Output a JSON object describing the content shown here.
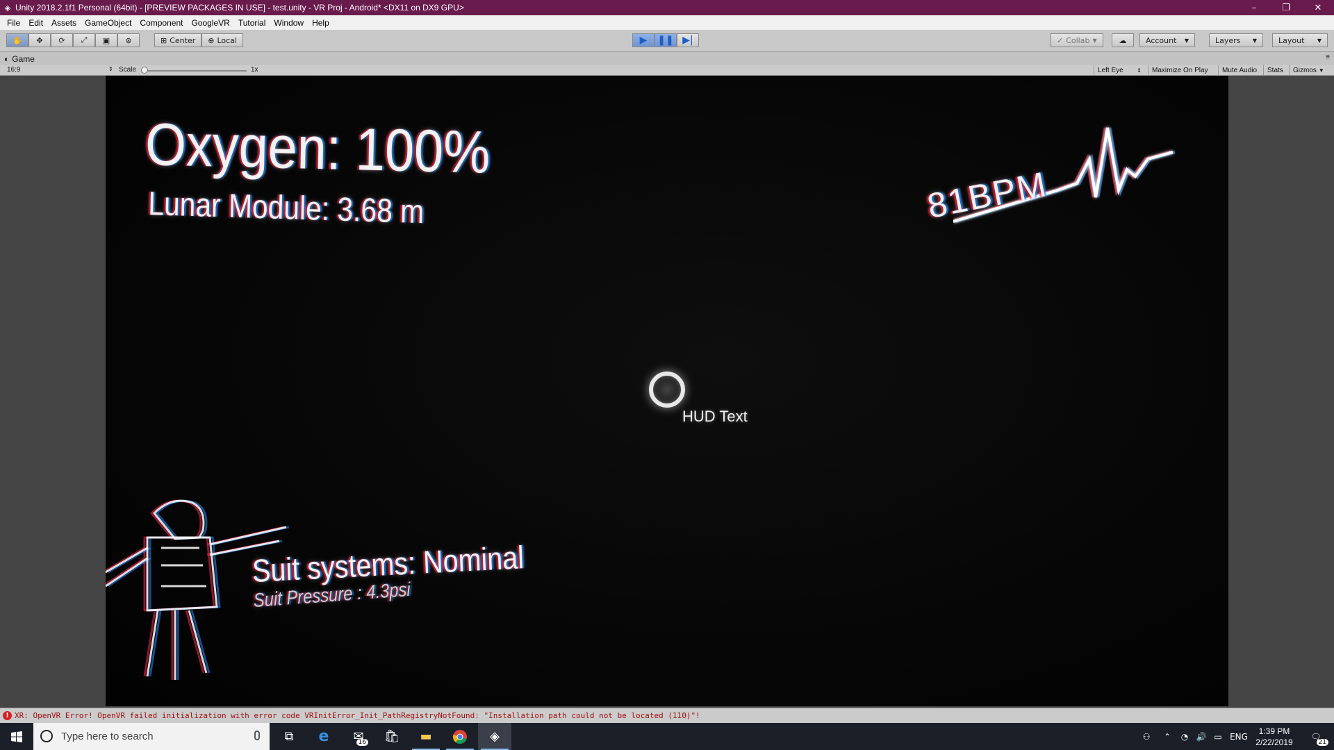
{
  "window": {
    "title": "Unity 2018.2.1f1 Personal (64bit) - [PREVIEW PACKAGES IN USE] - test.unity - VR Proj - Android* <DX11 on DX9 GPU>",
    "controls": {
      "minimize": "–",
      "restore": "❐",
      "close": "✕"
    }
  },
  "menu": [
    "File",
    "Edit",
    "Assets",
    "GameObject",
    "Component",
    "GoogleVR",
    "Tutorial",
    "Window",
    "Help"
  ],
  "toolbar": {
    "tools": [
      "hand-tool-icon",
      "move-tool-icon",
      "rotate-tool-icon",
      "scale-tool-icon",
      "rect-tool-icon",
      "transform-tool-icon"
    ],
    "pivot_mode": "Center",
    "pivot_rotation": "Local",
    "collab": "Collab",
    "account": "Account",
    "layers": "Layers",
    "layout": "Layout"
  },
  "game_tab": {
    "label": "Game",
    "aspect": "16:9",
    "scale_label": "Scale",
    "scale_value": "1x",
    "display": "Left Eye",
    "maximize": "Maximize On Play",
    "mute": "Mute Audio",
    "stats": "Stats",
    "gizmos": "Gizmos"
  },
  "hud": {
    "oxygen": "Oxygen: 100%",
    "lunar_module": "Lunar Module: 3.68 m",
    "heart_rate": "81BPM",
    "suit_systems": "Suit systems: Nominal",
    "suit_pressure": "Suit Pressure : 4.3psi",
    "center_text": "HUD Text"
  },
  "console": {
    "message": "XR: OpenVR Error! OpenVR failed initialization with error code VRInitError_Init_PathRegistryNotFound: \"Installation path could not be located (110)\"!"
  },
  "taskbar": {
    "search_placeholder": "Type here to search",
    "mail_badge": "16",
    "language": "ENG",
    "time": "1:39 PM",
    "date": "2/22/2019",
    "notifications": "21"
  },
  "colors": {
    "title_bar": "#6a1b4d",
    "play_active": "#6f93d2",
    "error": "#d42020"
  }
}
